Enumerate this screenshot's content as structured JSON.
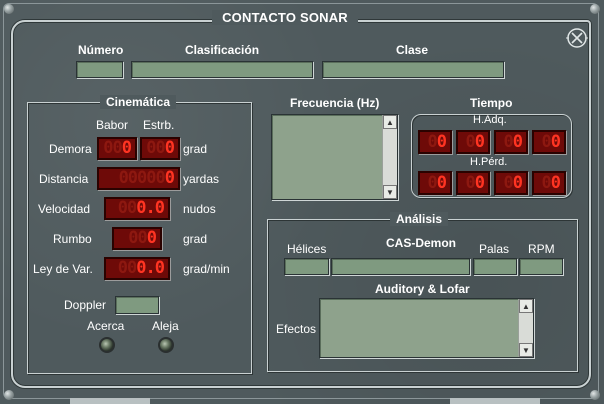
{
  "window": {
    "title": "CONTACTO SONAR"
  },
  "header": {
    "numero_label": "Número",
    "clasificacion_label": "Clasificación",
    "clase_label": "Clase",
    "numero_value": "",
    "clasificacion_value": "",
    "clase_value": ""
  },
  "cinematica": {
    "title": "Cinemática",
    "babor_label": "Babor",
    "estrb_label": "Estrb.",
    "rows": [
      {
        "label": "Demora",
        "unit": "grad"
      },
      {
        "label": "Distancia",
        "unit": "yardas"
      },
      {
        "label": "Velocidad",
        "unit": "nudos"
      },
      {
        "label": "Rumbo",
        "unit": "grad"
      },
      {
        "label": "Ley de Var.",
        "unit": "grad/min"
      }
    ],
    "demora_babor": {
      "dim": "00",
      "lit": "0"
    },
    "demora_estrb": {
      "dim": "00",
      "lit": "0"
    },
    "distancia": {
      "dim": "00000",
      "lit": "0"
    },
    "velocidad": {
      "dim": "00",
      "lit": "0.0"
    },
    "rumbo": {
      "dim": "00",
      "lit": "0"
    },
    "ley_var": {
      "dim": "00",
      "lit": "0.0"
    },
    "doppler_label": "Doppler",
    "doppler_value": "",
    "acerca_label": "Acerca",
    "aleja_label": "Aleja"
  },
  "frecuencia": {
    "title": "Frecuencia  (Hz)"
  },
  "tiempo": {
    "title": "Tiempo",
    "hadq_label": "H.Adq.",
    "hperd_label": "H.Pérd.",
    "hadq": [
      {
        "dim": "0",
        "lit": "0"
      },
      {
        "dim": "0",
        "lit": "0"
      },
      {
        "dim": "0",
        "lit": "0"
      },
      {
        "dim": "0",
        "lit": "0"
      }
    ],
    "hperd": [
      {
        "dim": "0",
        "lit": "0"
      },
      {
        "dim": "0",
        "lit": "0"
      },
      {
        "dim": "0",
        "lit": "0"
      },
      {
        "dim": "0",
        "lit": "0"
      }
    ]
  },
  "analisis": {
    "title": "Análisis",
    "helices_label": "Hélices",
    "cas_demon_label": "CAS-Demon",
    "palas_label": "Palas",
    "rpm_label": "RPM",
    "auditory_lofar_label": "Auditory & Lofar",
    "efectos_label": "Efectos"
  },
  "icons": {
    "close": "close-icon",
    "scroll_up": "up-arrow-icon",
    "scroll_down": "down-arrow-icon"
  },
  "colors": {
    "panel": "#4f5a5d",
    "field": "#7f9a80",
    "led_on": "#ff3422",
    "led_off": "#8d1810"
  }
}
